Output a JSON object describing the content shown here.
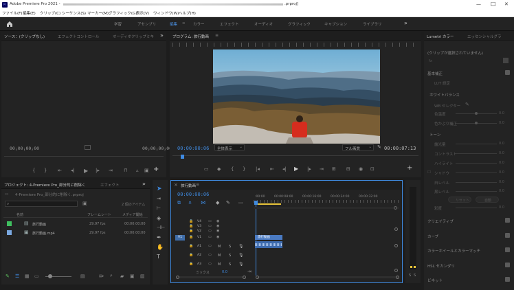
{
  "app": {
    "title": "Adobe Premiere Pro 2021 -",
    "title_path_end": ".prproj]"
  },
  "window_controls": {
    "minimize": "—",
    "maximize": "□",
    "close": "✕"
  },
  "menu": [
    "ファイル(F)",
    "編集(E)",
    "クリップ(C)",
    "シーケンス(S)",
    "マーカー(M)",
    "グラフィック(G)",
    "表示(V)",
    "ウィンドウ(W)",
    "ヘルプ(H)"
  ],
  "workspaces": [
    "学習",
    "アセンブリ",
    "編集",
    "カラー",
    "エフェクト",
    "オーディオ",
    "グラフィック",
    "キャプション",
    "ライブラリ"
  ],
  "workspace_active": "編集",
  "source_panel": {
    "tabs": [
      "ソース：(クリップなし)",
      "エフェクトコントロール",
      "オーディオクリップミキ"
    ],
    "timecode_left": "00;00;00;00",
    "timecode_right": "00;00;00;00"
  },
  "program_panel": {
    "tab": "プログラム: 旅行動画",
    "timecode_current": "00:00:00:06",
    "fit_label": "全体表示",
    "quality_label": "フル画質",
    "timecode_duration": "00:00:07:13"
  },
  "lumetri": {
    "tabs": [
      "Lumetri カラー",
      "エッセンシャルグラ"
    ],
    "no_clip": "(クリップが選択されていません)",
    "basic": "基本補正",
    "lut_label": "LUT 設定",
    "white_balance": "ホワイトバランス",
    "wb_select": "WB セレクター",
    "temperature": "色温度",
    "tint": "色かぶり補正",
    "tone": "トーン",
    "tone_items": [
      "露光量",
      "コントラスト",
      "ハイライト",
      "シャドウ",
      "白レベル",
      "黒レベル"
    ],
    "zero": "0.0",
    "reset_btn": "リセット",
    "auto_btn": "自動",
    "saturation": "彩度",
    "sections": [
      "クリエイティブ",
      "カーブ",
      "カラーホイールとカラーマッチ",
      "HSL セカンダリ",
      "ビネット"
    ]
  },
  "project_panel": {
    "tabs": [
      "プロジェクト: 4-Premiere Pro_部分的に削除く",
      "エフェクト"
    ],
    "path": "4-Premiere Pro_部分的に削除く.prproj",
    "item_count": "2 個のアイテム",
    "columns": [
      "名前",
      "フレームレート",
      "メディア開始"
    ],
    "items": [
      {
        "name": "旅行動画",
        "rate": "29.97 fps",
        "start": "00:00:00:00",
        "color": "#3fbf5f"
      },
      {
        "name": "旅行動画.mp4",
        "rate": "29.97 fps",
        "start": "00:00:00:00",
        "color": "#7aa8e0"
      }
    ]
  },
  "timeline": {
    "tab": "旅行動画",
    "timecode": "00:00:00:06",
    "ruler": [
      ":00:00",
      "00:00:08:00",
      "00:00:16:00",
      "00:00:24:00",
      "00:00:32:00"
    ],
    "video_tracks": [
      "V3",
      "V2",
      "V1"
    ],
    "top_track": "V4",
    "audio_tracks": [
      "A1",
      "A2",
      "A3"
    ],
    "source_patch": "V1",
    "clip_label": "旅行動画",
    "mix_label": "ミックス",
    "mix_value": "0.0"
  },
  "meter": {
    "labels": [
      "S",
      "S"
    ]
  }
}
